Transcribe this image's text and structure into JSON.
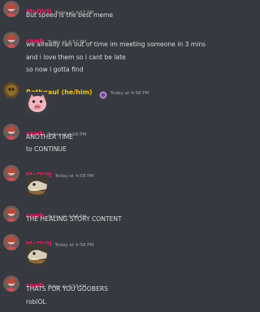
{
  "colors": {
    "background": "#36393f",
    "name_pink": "#e91e63",
    "name_yellow": "#f1c40f",
    "timestamp": "#a3a6aa",
    "text": "#dcddde"
  },
  "messages": [
    {
      "author": "MsOVII",
      "time": "Today at 4:57 PM",
      "lines": [
        "But speed is the best meme"
      ]
    },
    {
      "author": "rawb",
      "time": "Today at 4:57 PM",
      "lines": [
        "we already ran out of time im meeting someone in 3 mins",
        "and i love them so i cant be late",
        "so now i gotta find"
      ]
    },
    {
      "author": "Rethgaul (he/him)",
      "time": "Today at 4:58 PM",
      "lines": []
    },
    {
      "author": "rawb",
      "time": "Today at 4:58 PM",
      "lines": [
        "ANOTHER TIME",
        "to CONTINUE"
      ]
    },
    {
      "author": "MsOVII",
      "time": "Today at 4:58 PM",
      "lines": []
    },
    {
      "author": "rawb",
      "time": "Today at 4:58 PM",
      "lines": [
        "THE HEALING STORY CONTENT"
      ]
    },
    {
      "author": "MsOVII",
      "time": "Today at 4:58 PM",
      "lines": []
    },
    {
      "author": "rawb",
      "time": "Today at 4:58 PM",
      "lines": [
        "THATS FOR YOU GOOBERS",
        "roblOL"
      ]
    }
  ]
}
